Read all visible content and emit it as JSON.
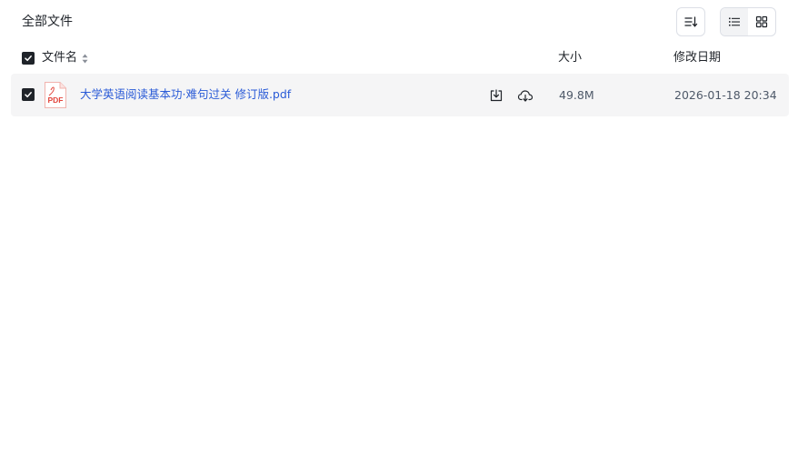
{
  "page": {
    "title": "全部文件"
  },
  "toolbar": {
    "sort_icon": "sort-list-icon",
    "view_list_icon": "list-view-icon",
    "view_grid_icon": "grid-view-icon",
    "active_view": "list"
  },
  "table": {
    "columns": {
      "name": "文件名",
      "size": "大小",
      "modified": "修改日期"
    },
    "select_all_checked": true,
    "rows": [
      {
        "checked": true,
        "icon": "pdf-file-icon",
        "icon_label": "PDF",
        "name": "大学英语阅读基本功·难句过关 修订版.pdf",
        "size": "49.8M",
        "modified": "2026-01-18 20:34",
        "actions": [
          "download-icon",
          "cloud-save-icon"
        ]
      }
    ]
  },
  "colors": {
    "accent_link": "#2a5bd7",
    "pdf_red": "#e2453c",
    "row_selected_bg": "#f5f5f6",
    "checkbox_bg": "#1f2329"
  }
}
